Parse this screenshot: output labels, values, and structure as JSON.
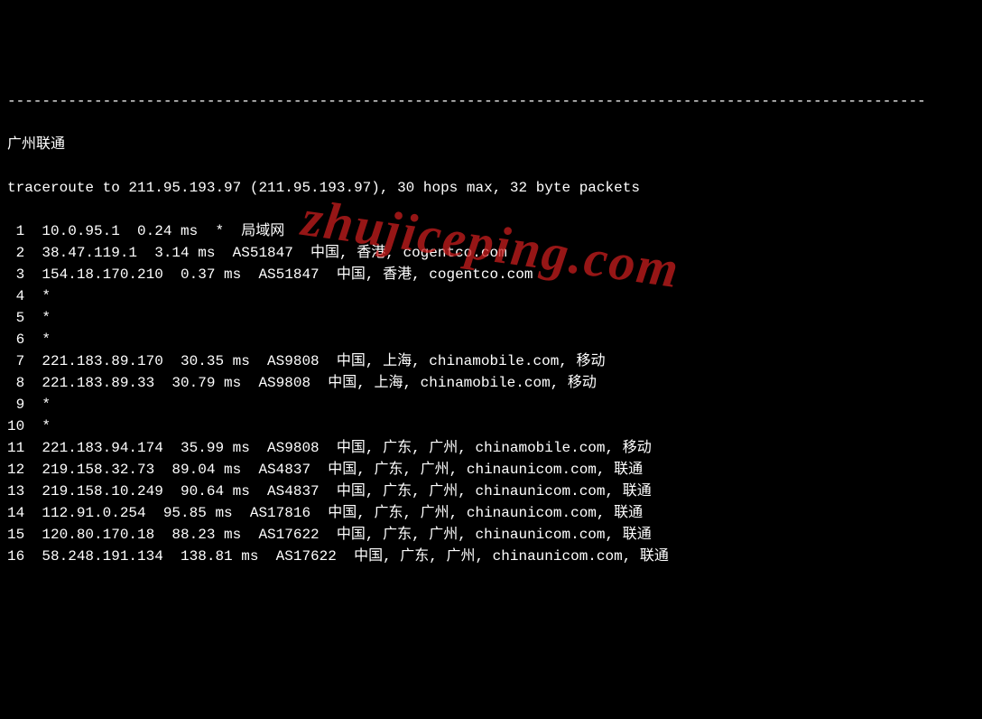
{
  "divider": "----------------------------------------------------------------------------------------------------------",
  "title": "广州联通",
  "header": "traceroute to 211.95.193.97 (211.95.193.97), 30 hops max, 32 byte packets",
  "watermark": "zhujiceping.com",
  "hops": [
    {
      "num": "1",
      "ip": "10.0.95.1",
      "latency": "0.24 ms",
      "asn": "*",
      "location": "局域网"
    },
    {
      "num": "2",
      "ip": "38.47.119.1",
      "latency": "3.14 ms",
      "asn": "AS51847",
      "location": "中国, 香港, cogentco.com"
    },
    {
      "num": "3",
      "ip": "154.18.170.210",
      "latency": "0.37 ms",
      "asn": "AS51847",
      "location": "中国, 香港, cogentco.com"
    },
    {
      "num": "4",
      "ip": "*",
      "latency": "",
      "asn": "",
      "location": ""
    },
    {
      "num": "5",
      "ip": "*",
      "latency": "",
      "asn": "",
      "location": ""
    },
    {
      "num": "6",
      "ip": "*",
      "latency": "",
      "asn": "",
      "location": ""
    },
    {
      "num": "7",
      "ip": "221.183.89.170",
      "latency": "30.35 ms",
      "asn": "AS9808",
      "location": "中国, 上海, chinamobile.com, 移动"
    },
    {
      "num": "8",
      "ip": "221.183.89.33",
      "latency": "30.79 ms",
      "asn": "AS9808",
      "location": "中国, 上海, chinamobile.com, 移动"
    },
    {
      "num": "9",
      "ip": "*",
      "latency": "",
      "asn": "",
      "location": ""
    },
    {
      "num": "10",
      "ip": "*",
      "latency": "",
      "asn": "",
      "location": ""
    },
    {
      "num": "11",
      "ip": "221.183.94.174",
      "latency": "35.99 ms",
      "asn": "AS9808",
      "location": "中国, 广东, 广州, chinamobile.com, 移动"
    },
    {
      "num": "12",
      "ip": "219.158.32.73",
      "latency": "89.04 ms",
      "asn": "AS4837",
      "location": "中国, 广东, 广州, chinaunicom.com, 联通"
    },
    {
      "num": "13",
      "ip": "219.158.10.249",
      "latency": "90.64 ms",
      "asn": "AS4837",
      "location": "中国, 广东, 广州, chinaunicom.com, 联通"
    },
    {
      "num": "14",
      "ip": "112.91.0.254",
      "latency": "95.85 ms",
      "asn": "AS17816",
      "location": "中国, 广东, 广州, chinaunicom.com, 联通"
    },
    {
      "num": "15",
      "ip": "120.80.170.18",
      "latency": "88.23 ms",
      "asn": "AS17622",
      "location": "中国, 广东, 广州, chinaunicom.com, 联通"
    },
    {
      "num": "16",
      "ip": "58.248.191.134",
      "latency": "138.81 ms",
      "asn": "AS17622",
      "location": "中国, 广东, 广州, chinaunicom.com, 联通"
    }
  ]
}
